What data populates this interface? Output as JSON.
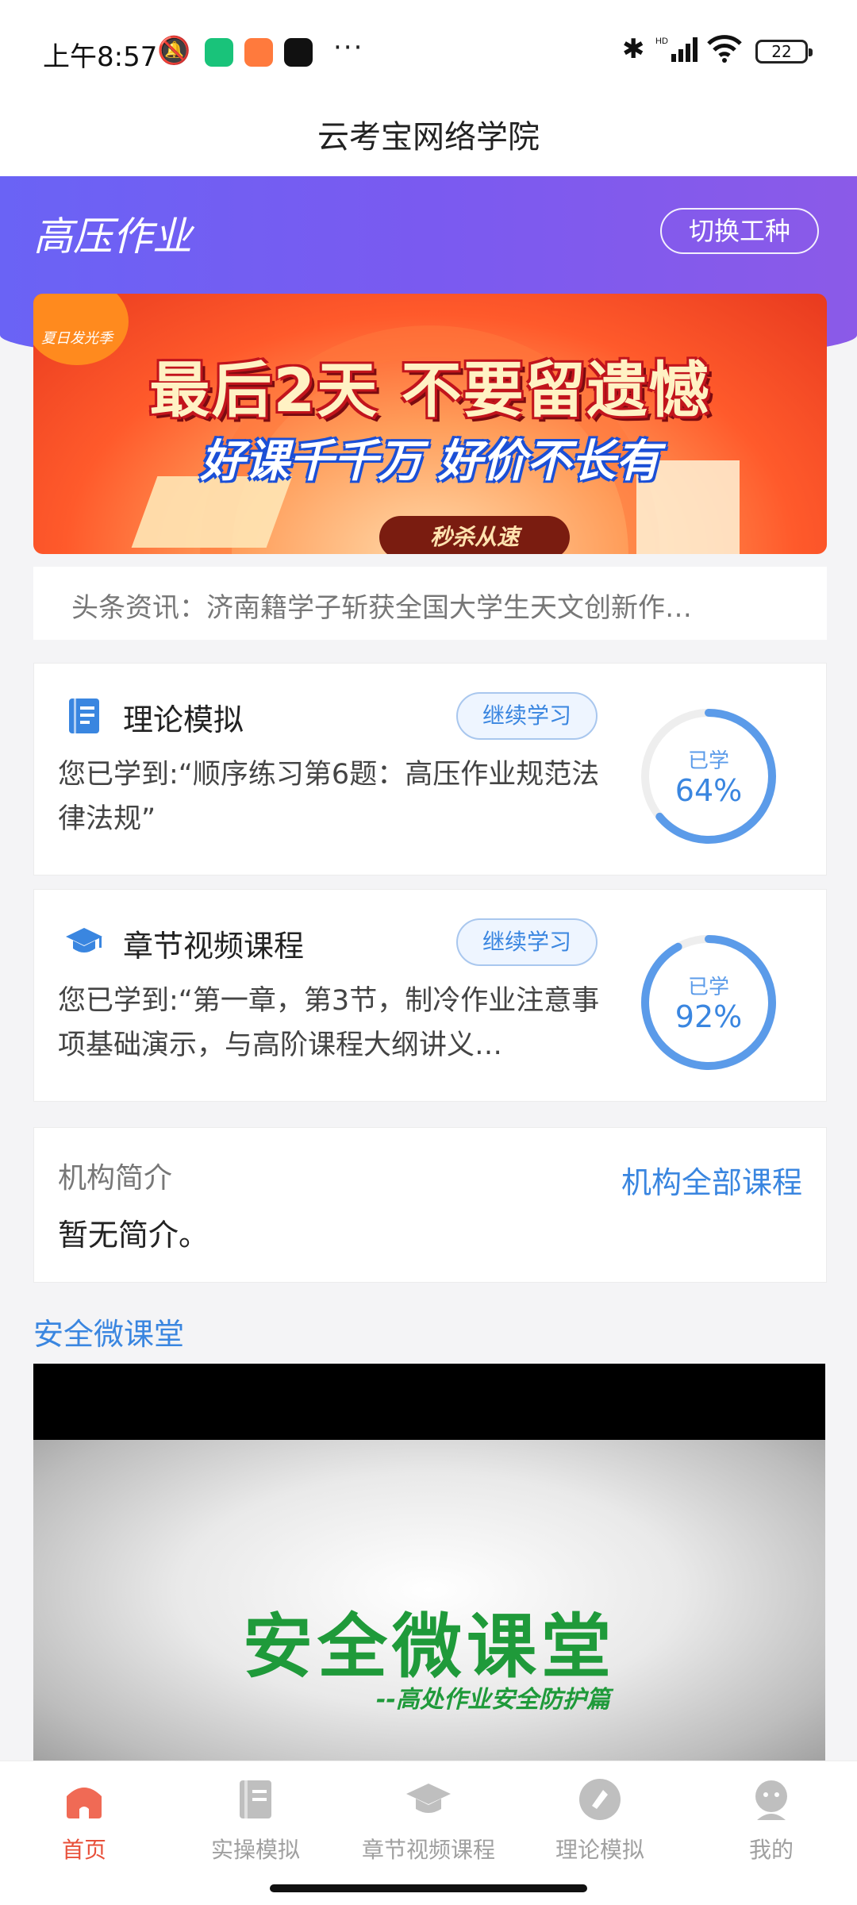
{
  "status_bar": {
    "time": "上午8:57",
    "battery": "22",
    "more": "···",
    "network": "HD"
  },
  "header": {
    "title": "云考宝网络学院"
  },
  "hero": {
    "category_title": "高压作业",
    "switch_label": "切换工种",
    "gradient_colors": [
      "#6a63f5",
      "#8b5ae8"
    ]
  },
  "banner": {
    "badge": "夏日发光季",
    "line1": "最后2天 不要留遗憾",
    "line2": "好课千千万 好价不长有",
    "cta": "秒杀从速"
  },
  "news": {
    "text": "头条资讯：济南籍学子斩获全国大学生天文创新作…"
  },
  "cards": [
    {
      "icon": "book-icon",
      "title": "理论模拟",
      "button": "继续学习",
      "description": "您已学到:“顺序练习第6题：高压作业规范法律法规”",
      "progress_label": "已学",
      "progress_text": "64%",
      "progress": 0.64
    },
    {
      "icon": "graduation-cap-icon",
      "title": "章节视频课程",
      "button": "继续学习",
      "description": "您已学到:“第一章，第3节，制冷作业注意事项基础演示，与高阶课程大纲讲义…",
      "progress_label": "已学",
      "progress_text": "92%",
      "progress": 0.92
    }
  ],
  "org": {
    "title": "机构简介",
    "link": "机构全部课程",
    "description": "暂无简介。"
  },
  "section": {
    "title": "安全微课堂",
    "video_title": "安全微课堂",
    "video_subtitle": "--高处作业安全防护篇"
  },
  "nav": {
    "items": [
      {
        "label": "首页",
        "icon": "home-icon",
        "active": true
      },
      {
        "label": "实操模拟",
        "icon": "document-icon",
        "active": false
      },
      {
        "label": "章节视频课程",
        "icon": "graduation-cap-icon",
        "active": false
      },
      {
        "label": "理论模拟",
        "icon": "pen-icon",
        "active": false
      },
      {
        "label": "我的",
        "icon": "user-icon",
        "active": false
      }
    ]
  },
  "colors": {
    "accent_blue": "#3a86e0",
    "active_red": "#e8503a",
    "ring_track": "#eeeeee"
  }
}
